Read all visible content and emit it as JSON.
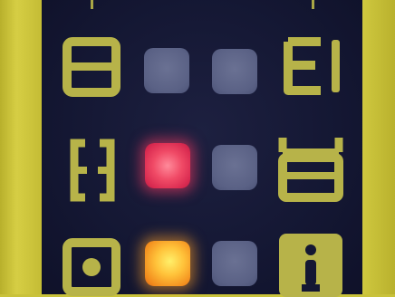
{
  "device_panel": {
    "rows": [
      {
        "left_icon": "split-box-icon",
        "leds": [
          "off",
          "off"
        ],
        "right_icon": "e-glyph-icon"
      },
      {
        "left_icon": "bracket-glyph-icon",
        "leds": [
          "red",
          "off"
        ],
        "right_icon": "tray-glyph-icon"
      },
      {
        "left_icon": "dot-box-icon",
        "leds": [
          "amber",
          "off"
        ],
        "right_icon": "info-icon"
      }
    ],
    "colors": {
      "frame": "#c9c23a",
      "panel": "#141733",
      "icon": "#b7b349",
      "led_off": "#5a6185",
      "led_red": "#f04a66",
      "led_amber": "#ffc23a"
    }
  }
}
